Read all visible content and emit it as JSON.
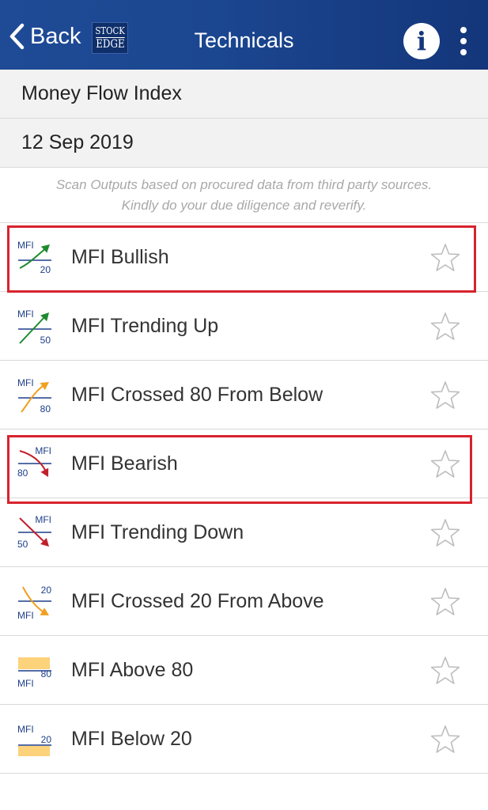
{
  "header": {
    "back_label": "Back",
    "logo_line1": "STOCK",
    "logo_line2": "EDGE",
    "title": "Technicals",
    "info_glyph": "i"
  },
  "scan": {
    "name": "Money Flow Index",
    "date": "12 Sep 2019",
    "disclaimer_line1": "Scan Outputs based on procured data from third party sources.",
    "disclaimer_line2": "Kindly do your due diligence and reverify."
  },
  "items": [
    {
      "label": "MFI Bullish",
      "icon": "mfi-bullish-icon",
      "icon_top": "MFI",
      "icon_bottom": "20",
      "highlighted": true
    },
    {
      "label": "MFI Trending Up",
      "icon": "mfi-trending-up-icon",
      "icon_top": "MFI",
      "icon_bottom": "50",
      "highlighted": false
    },
    {
      "label": "MFI Crossed 80 From Below",
      "icon": "mfi-crossed-80-from-below-icon",
      "icon_top": "MFI",
      "icon_bottom": "80",
      "highlighted": false
    },
    {
      "label": "MFI Bearish",
      "icon": "mfi-bearish-icon",
      "icon_top": "MFI",
      "icon_bottom": "80",
      "highlighted": true
    },
    {
      "label": "MFI Trending Down",
      "icon": "mfi-trending-down-icon",
      "icon_top": "MFI",
      "icon_bottom": "50",
      "highlighted": false
    },
    {
      "label": "MFI Crossed 20 From Above",
      "icon": "mfi-crossed-20-from-above-icon",
      "icon_top": "20",
      "icon_bottom": "MFI",
      "highlighted": false
    },
    {
      "label": "MFI Above 80",
      "icon": "mfi-above-80-icon",
      "icon_top": "80",
      "icon_bottom": "MFI",
      "highlighted": false
    },
    {
      "label": "MFI Below 20",
      "icon": "mfi-below-20-icon",
      "icon_top": "MFI",
      "icon_bottom": "20",
      "highlighted": false
    }
  ],
  "colors": {
    "navbar": "#1b4690",
    "bullish_green": "#1e8a2e",
    "bearish_red": "#c0202c",
    "crossing_orange": "#f0a020",
    "zone_yellow": "#fcd27a",
    "icon_blue": "#1d3f8a",
    "highlight_red": "#d7232e",
    "star_gray": "#bdbdbd"
  }
}
